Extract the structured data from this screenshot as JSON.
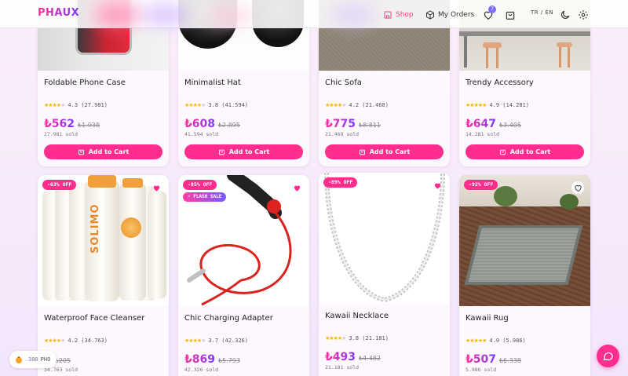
{
  "header": {
    "logo": "PHAUX",
    "nav_shop": "Shop",
    "nav_orders": "My Orders",
    "wishlist_count": "7",
    "lang": "TR / EN"
  },
  "products": [
    {
      "title": "Foldable Phone Case",
      "stars": 4,
      "rating": "4.3",
      "reviews": "(27.981)",
      "price": "₺562",
      "old_price": "₺1.938",
      "sold": "27.981 sold",
      "cart": "Add to Cart"
    },
    {
      "title": "Minimalist Hat",
      "stars": 4,
      "rating": "3.8",
      "reviews": "(41.594)",
      "price": "₺608",
      "old_price": "₺2.895",
      "sold": "41.594 sold",
      "cart": "Add to Cart"
    },
    {
      "title": "Chic Sofa",
      "stars": 4,
      "rating": "4.2",
      "reviews": "(21.468)",
      "price": "₺775",
      "old_price": "₺8.811",
      "sold": "21.468 sold",
      "cart": "Add to Cart"
    },
    {
      "title": "Trendy Accessory",
      "stars": 5,
      "rating": "4.9",
      "reviews": "(14.281)",
      "price": "₺647",
      "old_price": "₺3.405",
      "sold": "14.281 sold",
      "cart": "Add to Cart"
    },
    {
      "title": "Waterproof Face Cleanser",
      "stars": 4,
      "rating": "4.2",
      "reviews": "(34.763)",
      "price": "₺",
      "old_price": "₺205",
      "sold": "34.763 sold",
      "discount": "-63% OFF"
    },
    {
      "title": "Chic Charging Adapter",
      "stars": 4,
      "rating": "3.7",
      "reviews": "(42.326)",
      "price": "₺869",
      "old_price": "₺5.793",
      "sold": "42.326 sold",
      "discount": "-85% OFF",
      "flash": "⚡ FLASH SALE"
    },
    {
      "title": "Kawaii Necklace",
      "stars": 4,
      "rating": "3.8",
      "reviews": "(21.181)",
      "price": "₺493",
      "old_price": "₺4.482",
      "sold": "21.181 sold",
      "discount": "-89% OFF"
    },
    {
      "title": "Kawaii Rug",
      "stars": 5,
      "rating": "4.9",
      "reviews": "(5.986)",
      "price": "₺507",
      "old_price": "₺6.338",
      "sold": "5.986 sold",
      "discount": "-92% OFF"
    }
  ],
  "coins": {
    "value": "300",
    "unit": "PHO"
  },
  "colors": {
    "accent": "#ff2e8e",
    "gradient_end": "#7a3cff"
  }
}
